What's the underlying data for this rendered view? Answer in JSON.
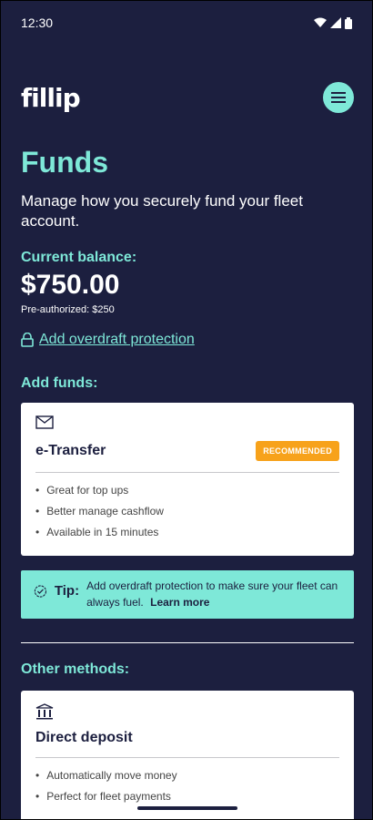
{
  "status_bar": {
    "time": "12:30"
  },
  "header": {
    "logo": "fillip",
    "menu_icon": "hamburger-icon"
  },
  "page": {
    "title": "Funds",
    "subtitle": "Manage how you securely fund your fleet account.",
    "balance_label": "Current balance:",
    "balance_amount": "$750.00",
    "preauthorized": "Pre-authorized: $250",
    "overdraft_link": "Add overdraft protection"
  },
  "add_funds": {
    "title": "Add funds:",
    "etransfer": {
      "icon": "envelope-icon",
      "title": "e-Transfer",
      "badge": "RECOMMENDED",
      "bullets": [
        "Great for top ups",
        "Better manage cashflow",
        "Available in 15 minutes"
      ]
    }
  },
  "tip": {
    "label": "Tip:",
    "text": "Add overdraft protection to make sure your fleet can always fuel.",
    "link": "Learn more"
  },
  "other_methods": {
    "title": "Other methods:",
    "direct_deposit": {
      "icon": "bank-icon",
      "title": "Direct deposit",
      "bullets": [
        "Automatically move money",
        "Perfect for fleet payments"
      ]
    }
  },
  "colors": {
    "background": "#1c1f3f",
    "accent": "#7ee8d8",
    "badge": "#f7a21b"
  }
}
